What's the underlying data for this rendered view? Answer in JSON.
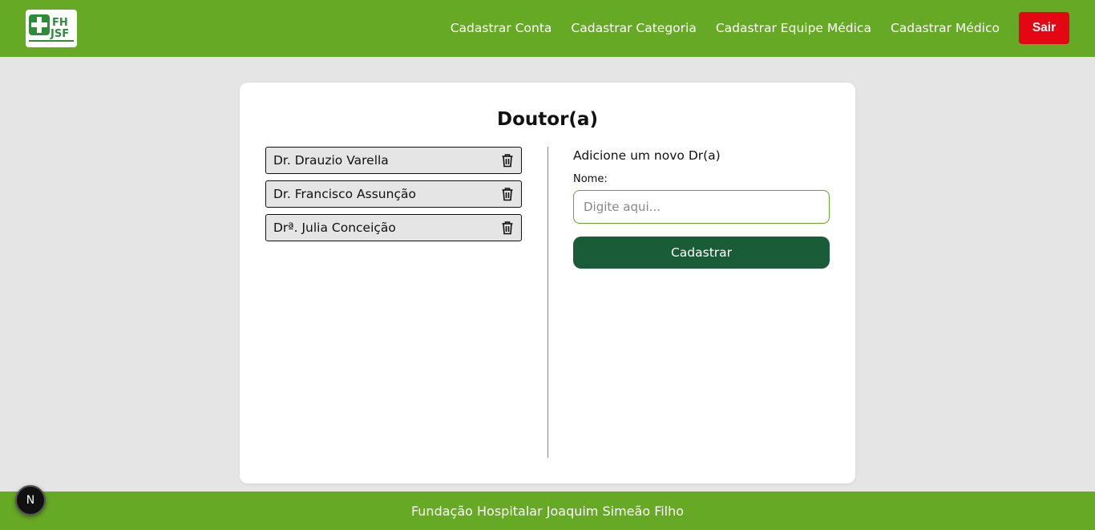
{
  "header": {
    "logo_text": "FHJSF",
    "nav": [
      "Cadastrar Conta",
      "Cadastrar Categoria",
      "Cadastrar Equipe Médica",
      "Cadastrar Médico"
    ],
    "logout_label": "Sair"
  },
  "card": {
    "title": "Doutor(a)",
    "doctors": [
      "Dr. Drauzio Varella",
      "Dr. Francisco Assunção",
      "Drª. Julia Conceição"
    ],
    "form": {
      "heading": "Adicione um novo Dr(a)",
      "name_label": "Nome:",
      "name_placeholder": "Digite aqui...",
      "name_value": "",
      "submit_label": "Cadastrar"
    }
  },
  "footer": {
    "text": "Fundação Hospitalar Joaquim Simeão Filho"
  },
  "dev_badge": {
    "label": "N"
  },
  "colors": {
    "brand_green": "#66a925",
    "dark_green": "#1a5c37",
    "logout_red": "#e40613",
    "background": "#e5e5e5"
  }
}
